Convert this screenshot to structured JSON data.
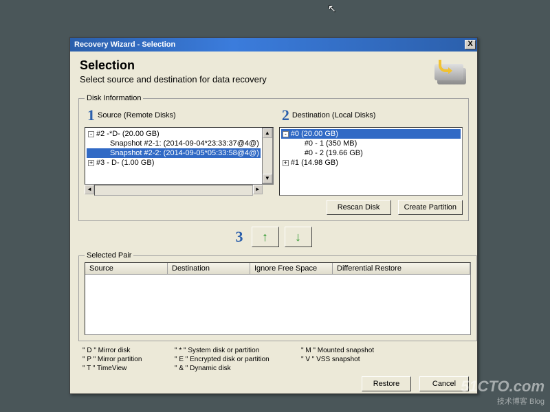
{
  "titlebar": {
    "text": "Recovery Wizard - Selection",
    "close": "X"
  },
  "header": {
    "title": "Selection",
    "subtitle": "Select source and destination for data recovery"
  },
  "disk_info": {
    "legend": "Disk Information",
    "source": {
      "num": "1",
      "label": "Source (Remote Disks)",
      "items": [
        {
          "indent": 0,
          "exp": "-",
          "text": "#2 -*D- (20.00 GB)",
          "sel": false
        },
        {
          "indent": 1,
          "exp": "",
          "text": "Snapshot #2-1: (2014-09-04*23:33:37@4@)",
          "sel": false
        },
        {
          "indent": 1,
          "exp": "",
          "text": "Snapshot #2-2: (2014-09-05*05:33:58@4@)",
          "sel": true
        },
        {
          "indent": 0,
          "exp": "+",
          "text": "#3 - D- (1.00 GB)",
          "sel": false
        }
      ]
    },
    "dest": {
      "num": "2",
      "label": "Destination (Local Disks)",
      "items": [
        {
          "indent": 0,
          "exp": "-",
          "text": "#0 (20.00 GB)",
          "sel": true
        },
        {
          "indent": 1,
          "exp": "",
          "text": "#0 - 1 (350 MB)",
          "sel": false
        },
        {
          "indent": 1,
          "exp": "",
          "text": "#0 - 2 (19.66 GB)",
          "sel": false
        },
        {
          "indent": 0,
          "exp": "+",
          "text": "#1 (14.98 GB)",
          "sel": false
        }
      ]
    },
    "buttons": {
      "rescan": "Rescan Disk",
      "create": "Create Partition"
    }
  },
  "transfer": {
    "badge": "3"
  },
  "selected_pair": {
    "legend": "Selected Pair",
    "cols": [
      "Source",
      "Destination",
      "Ignore Free Space",
      "Differential Restore"
    ]
  },
  "sym_legend": [
    "\" D \" Mirror disk",
    "\" * \" System disk or partition",
    "\" M \" Mounted snapshot",
    "\" P \" Mirror partition",
    "\" E \" Encrypted disk or partition",
    "\" V \" VSS snapshot",
    "\" T \" TimeView",
    "\" & \" Dynamic disk"
  ],
  "footer": {
    "restore": "Restore",
    "cancel": "Cancel"
  },
  "watermark": {
    "main": "51CTO.com",
    "sub": "技术博客   Blog"
  }
}
